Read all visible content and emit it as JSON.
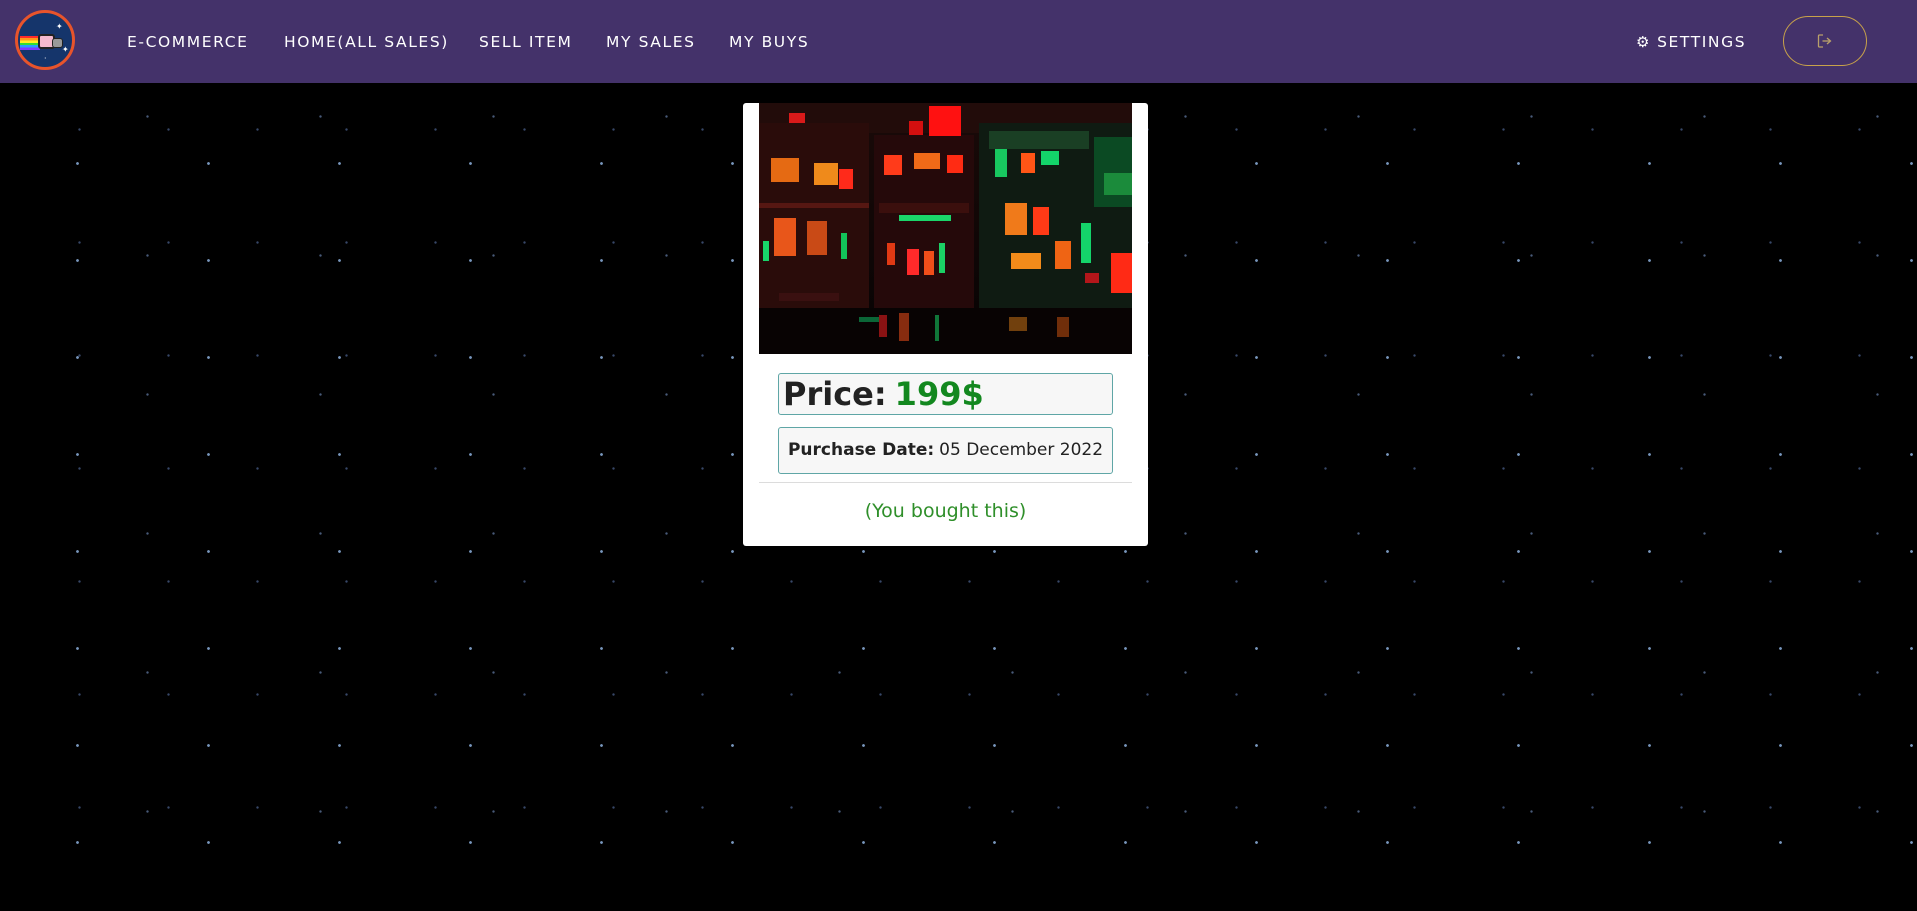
{
  "navbar": {
    "logo_alt": "nyan-cat-logo",
    "links": [
      {
        "label": "E-COMMERCE"
      },
      {
        "label": "HOME(ALL SALES)"
      },
      {
        "label": "SELL ITEM"
      },
      {
        "label": "MY SALES"
      },
      {
        "label": "MY BUYS"
      }
    ],
    "settings_label": "SETTINGS",
    "settings_icon": "gear-icon",
    "logout_icon": "sign-out-icon"
  },
  "card": {
    "image_description": "neon-city-artwork",
    "price_label": "Price:",
    "price_value": "199$",
    "purchase_date_label": "Purchase Date:",
    "purchase_date_value": "05 December 2022",
    "status": "(You bought this)"
  },
  "colors": {
    "navbar_bg": "#44326a",
    "price_green": "#13881f",
    "status_green": "#2f8f2a",
    "box_border": "#5fa6a6",
    "logout_border": "#c8a24a"
  }
}
